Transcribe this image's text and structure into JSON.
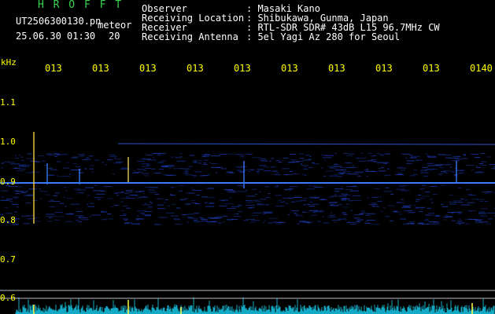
{
  "header": {
    "brand": "H R O F F T",
    "filename": "UT2506300130.pn",
    "datetime": "25.06.30 01:30",
    "label": "meteor",
    "count": "20"
  },
  "info": [
    {
      "label": "Observer",
      "value": ": Masaki Kano"
    },
    {
      "label": "Receiving Location",
      "value": ": Shibukawa, Gunma, Japan"
    },
    {
      "label": "Receiver",
      "value": ": RTL-SDR SDR# 43dB L15 96.7MHz CW"
    },
    {
      "label": "Receiving Antenna",
      "value": ": 5el Yagi Az 280 for Seoul"
    }
  ],
  "axis": {
    "unit": "kHz",
    "y_ticks": [
      "1.1",
      "1.0",
      "0.9",
      "0.8",
      "0.7",
      "0.6"
    ],
    "x_ticks": [
      "013",
      "013",
      "013",
      "013",
      "013",
      "013",
      "013",
      "013",
      "013",
      "0140"
    ]
  },
  "colors": {
    "background": "#000000",
    "header_green": "#39d353",
    "tick_yellow": "#ffff00",
    "signal_blue": "#2a5cff",
    "spectrum_cyan": "#18c8e8"
  }
}
